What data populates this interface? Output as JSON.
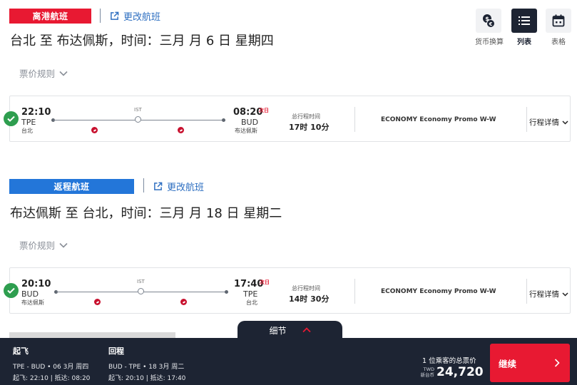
{
  "outbound": {
    "tag": "离港航班",
    "change_label": "更改航班",
    "title": "台北 至 布达佩斯，时间：三月 月 6 日 星期四",
    "fare_rules": "票价规则",
    "flight": {
      "dep_time": "22:10",
      "dep_code": "TPE",
      "dep_city": "台北",
      "arr_time": "08:20",
      "arr_code": "BUD",
      "arr_city": "布达佩斯",
      "next_day": "次日",
      "stop": "IST",
      "duration_label": "总行程时间",
      "duration": "17时 10分",
      "cabin": "ECONOMY Economy Promo W-W",
      "details": "行程详情"
    }
  },
  "inbound": {
    "tag": "返程航班",
    "change_label": "更改航班",
    "title": "布达佩斯 至 台北，时间：三月 月 18 日 星期二",
    "fare_rules": "票价规则",
    "flight": {
      "dep_time": "20:10",
      "dep_code": "BUD",
      "dep_city": "布达佩斯",
      "arr_time": "17:40",
      "arr_code": "TPE",
      "arr_city": "台北",
      "next_day": "次日",
      "stop": "IST",
      "duration_label": "总行程时间",
      "duration": "14时 30分",
      "cabin": "ECONOMY Economy Promo W-W",
      "details": "行程详情"
    }
  },
  "view_toggle": {
    "currency": "货币换算",
    "list": "列表",
    "table": "表格",
    "active": "list"
  },
  "footer": {
    "tab_label": "细节",
    "depart": {
      "heading": "起飞",
      "route": "TPE - BUD • 06 3月 周四",
      "times": "起飞: 22:10 | 抵达: 08:20"
    },
    "return": {
      "heading": "回程",
      "route": "BUD - TPE • 18 3月 周二",
      "times": "起飞: 20:10 | 抵达: 17:40"
    },
    "total_label": "1 位乘客的总票价",
    "currency_code": "TWD",
    "currency_name": "新台币",
    "amount": "24,720",
    "continue_label": "继续"
  },
  "colors": {
    "outbound_tag": "#e81932",
    "inbound_tag": "#2376d9",
    "footer_bg": "#1d2433",
    "continue_bg": "#e81932",
    "link": "#2e6fc1",
    "check": "#2e9e4f"
  }
}
